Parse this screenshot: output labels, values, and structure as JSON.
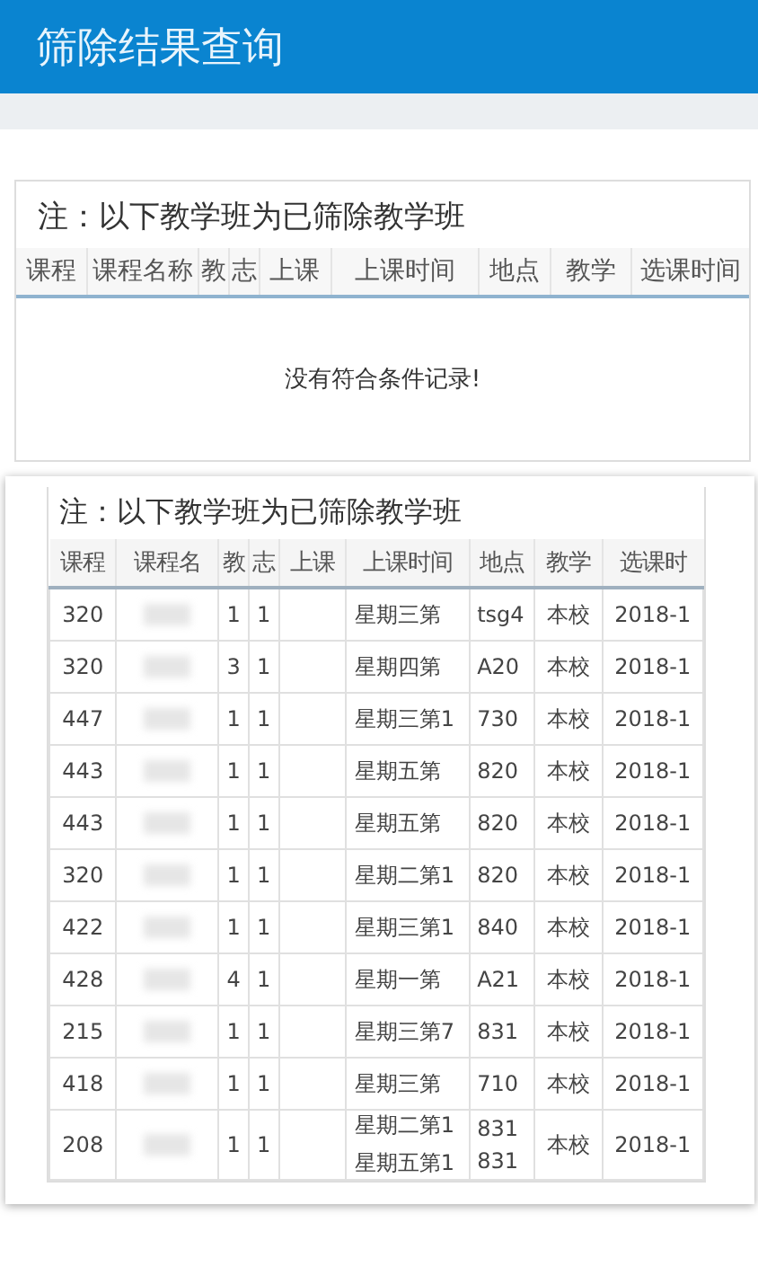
{
  "header": {
    "title": "筛除结果查询"
  },
  "empty_panel": {
    "note": "注：以下教学班为已筛除教学班",
    "columns": [
      "课程",
      "课程名称",
      "教",
      "志",
      "上课",
      "上课时间",
      "地点",
      "教学",
      "选课时间"
    ],
    "empty_message": "没有符合条件记录!"
  },
  "result_panel": {
    "note": "注：以下教学班为已筛除教学班",
    "columns": [
      "课程",
      "课程名",
      "教",
      "志",
      "上课",
      "上课时间",
      "地点",
      "教学",
      "选课时"
    ],
    "rows": [
      {
        "cells": [
          "320",
          "",
          "1",
          "1",
          "",
          [
            "星期三第"
          ],
          [
            "tsg4"
          ],
          "本校",
          "2018-1"
        ]
      },
      {
        "cells": [
          "320",
          "",
          "3",
          "1",
          "",
          [
            "星期四第"
          ],
          [
            "A20"
          ],
          "本校",
          "2018-1"
        ]
      },
      {
        "cells": [
          "447",
          "",
          "1",
          "1",
          "",
          [
            "星期三第1"
          ],
          [
            "730"
          ],
          "本校",
          "2018-1"
        ]
      },
      {
        "cells": [
          "443",
          "",
          "1",
          "1",
          "",
          [
            "星期五第"
          ],
          [
            "820"
          ],
          "本校",
          "2018-1"
        ]
      },
      {
        "cells": [
          "443",
          "",
          "1",
          "1",
          "",
          [
            "星期五第"
          ],
          [
            "820"
          ],
          "本校",
          "2018-1"
        ]
      },
      {
        "cells": [
          "320",
          "",
          "1",
          "1",
          "",
          [
            "星期二第1"
          ],
          [
            "820"
          ],
          "本校",
          "2018-1"
        ]
      },
      {
        "cells": [
          "422",
          "",
          "1",
          "1",
          "",
          [
            "星期三第1"
          ],
          [
            "840"
          ],
          "本校",
          "2018-1"
        ]
      },
      {
        "cells": [
          "428",
          "",
          "4",
          "1",
          "",
          [
            "星期一第"
          ],
          [
            "A21"
          ],
          "本校",
          "2018-1"
        ]
      },
      {
        "cells": [
          "215",
          "",
          "1",
          "1",
          "",
          [
            "星期三第7"
          ],
          [
            "831"
          ],
          "本校",
          "2018-1"
        ]
      },
      {
        "cells": [
          "418",
          "",
          "1",
          "1",
          "",
          [
            "星期三第"
          ],
          [
            "710"
          ],
          "本校",
          "2018-1"
        ]
      },
      {
        "cells": [
          "208",
          "",
          "1",
          "1",
          "",
          [
            "星期二第1",
            "星期五第1"
          ],
          [
            "831",
            "831"
          ],
          "本校",
          "2018-1"
        ]
      }
    ]
  }
}
